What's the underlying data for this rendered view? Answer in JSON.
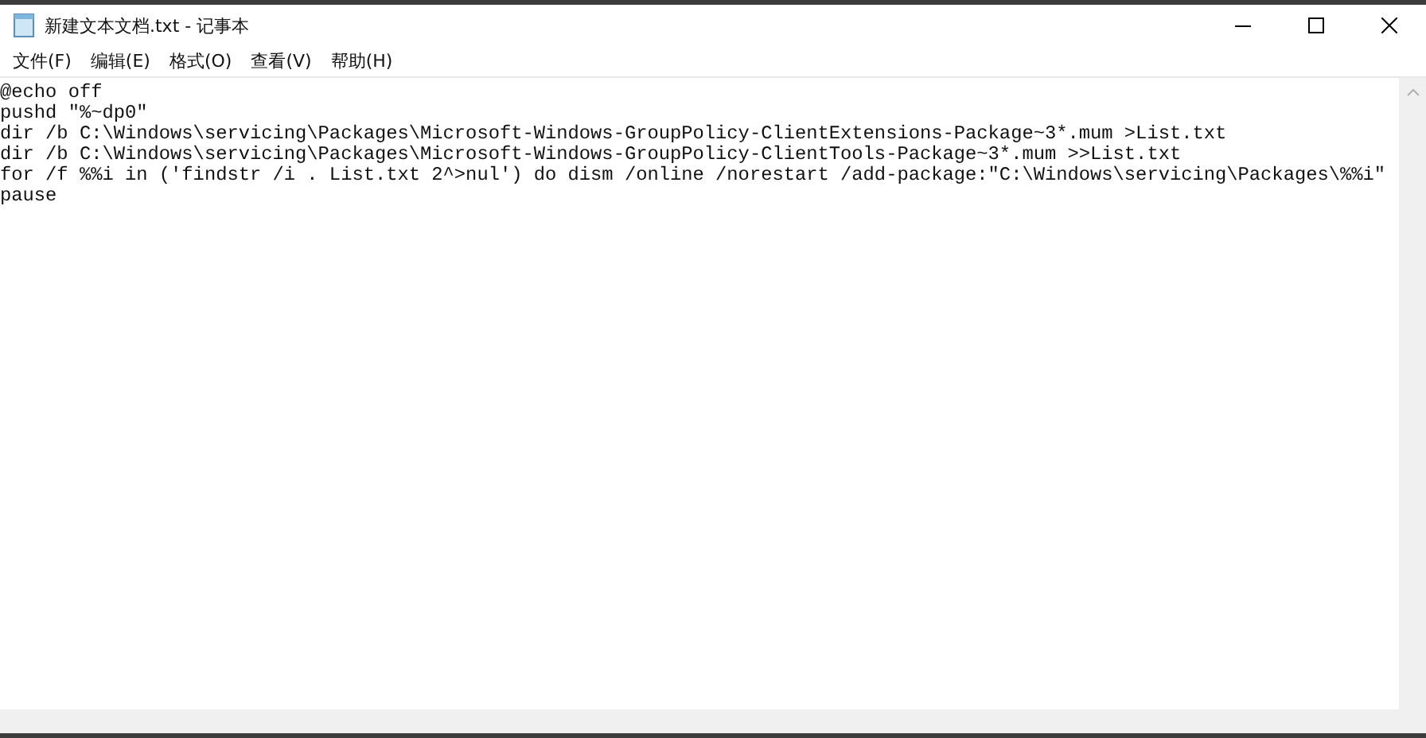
{
  "window": {
    "title": "新建文本文档.txt - 记事本"
  },
  "menu": [
    "文件(F)",
    "编辑(E)",
    "格式(O)",
    "查看(V)",
    "帮助(H)"
  ],
  "editor": {
    "lines": [
      "@echo off",
      "pushd \"%~dp0\"",
      "dir /b C:\\Windows\\servicing\\Packages\\Microsoft-Windows-GroupPolicy-ClientExtensions-Package~3*.mum >List.txt",
      "dir /b C:\\Windows\\servicing\\Packages\\Microsoft-Windows-GroupPolicy-ClientTools-Package~3*.mum >>List.txt",
      "for /f %%i in ('findstr /i . List.txt 2^>nul') do dism /online /norestart /add-package:\"C:\\Windows\\servicing\\Packages\\%%i\"",
      "pause"
    ]
  }
}
